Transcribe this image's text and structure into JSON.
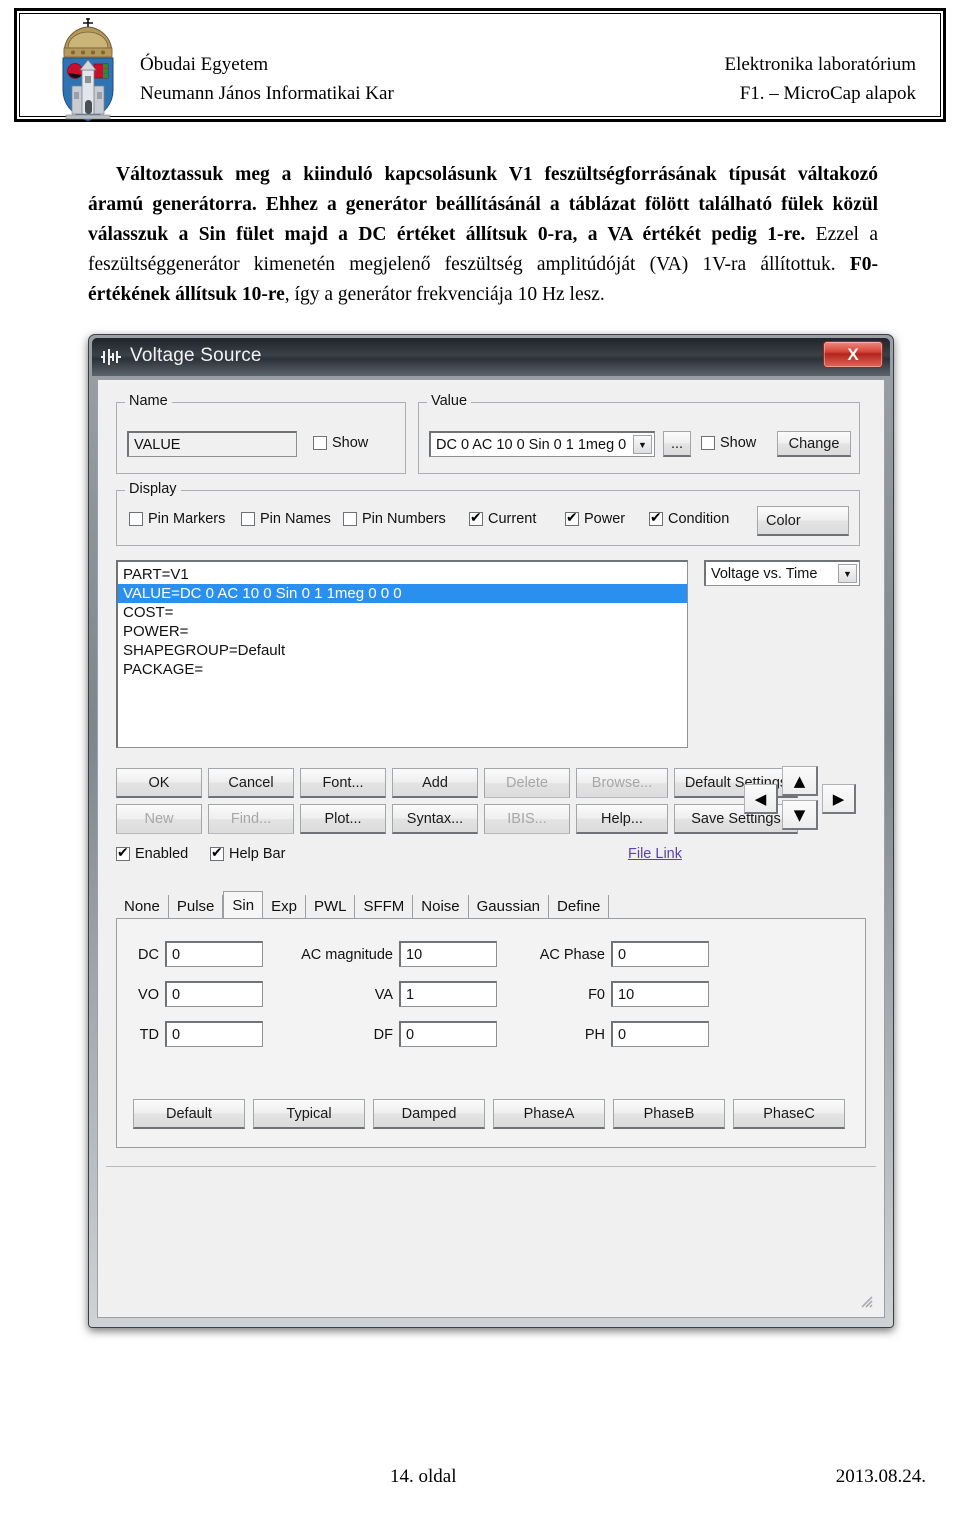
{
  "header": {
    "logo_alt": "obuda-university-crest",
    "left_line1": "Óbudai Egyetem",
    "left_line2": "Neumann János Informatikai Kar",
    "right_line1": "Elektronika laboratórium",
    "right_line2": "F1. – MicroCap alapok"
  },
  "body_text": {
    "p1_bold_a": "Változtassuk meg a kiinduló kapcsolásunk V1 feszültségforrásának típusát váltakozó áramú generátorra. Ehhez a generátor beállításánál a táblázat fölött található fülek közül válasszuk a Sin fület majd a DC értéket állítsuk 0-ra, a VA értékét pedig 1-re.",
    "p1_plain_a": " Ezzel a feszültséggenerátor kimenetén megjelenő feszültség amplitúdóját (VA) 1V-ra állítottuk. ",
    "p1_bold_b": "F0-értékének állítsuk 10-re",
    "p1_plain_b": ", így a generátor frekvenciája 10 Hz lesz."
  },
  "dialog": {
    "title": "Voltage Source",
    "title_icon": "voltage-source-icon",
    "close_label": "X",
    "name_group": {
      "legend": "Name",
      "value": "VALUE",
      "show_label": "Show",
      "show_checked": false
    },
    "value_group": {
      "legend": "Value",
      "value": "DC 0 AC 10 0 Sin 0 1 1meg 0",
      "browse_label": "...",
      "show_label": "Show",
      "show_checked": false,
      "change_label": "Change"
    },
    "display_group": {
      "legend": "Display",
      "checks": [
        {
          "label": "Pin Markers",
          "checked": false
        },
        {
          "label": "Pin Names",
          "checked": false
        },
        {
          "label": "Pin Numbers",
          "checked": false
        },
        {
          "label": "Current",
          "checked": true
        },
        {
          "label": "Power",
          "checked": true
        },
        {
          "label": "Condition",
          "checked": true
        }
      ],
      "color_label": "Color"
    },
    "property_list": [
      {
        "text": "PART=V1",
        "selected": false
      },
      {
        "text": "VALUE=DC 0 AC 10 0 Sin 0 1 1meg 0 0 0",
        "selected": true
      },
      {
        "text": "COST=",
        "selected": false
      },
      {
        "text": "POWER=",
        "selected": false
      },
      {
        "text": "SHAPEGROUP=Default",
        "selected": false
      },
      {
        "text": "PACKAGE=",
        "selected": false
      }
    ],
    "plot_combo": {
      "value": "Voltage vs. Time"
    },
    "buttons_row1": [
      {
        "label": "OK",
        "accel": "O",
        "disabled": false
      },
      {
        "label": "Cancel",
        "accel": "C",
        "disabled": false
      },
      {
        "label": "Font...",
        "accel": "F",
        "disabled": false
      },
      {
        "label": "Add",
        "accel": "A",
        "disabled": false
      },
      {
        "label": "Delete",
        "accel": "D",
        "disabled": true
      },
      {
        "label": "Browse...",
        "accel": "",
        "disabled": true
      },
      {
        "label": "Default Settings",
        "accel": "",
        "disabled": false
      }
    ],
    "buttons_row2": [
      {
        "label": "New",
        "accel": "",
        "disabled": true
      },
      {
        "label": "Find...",
        "accel": "",
        "disabled": true
      },
      {
        "label": "Plot...",
        "accel": "",
        "disabled": false
      },
      {
        "label": "Syntax...",
        "accel": "",
        "disabled": false
      },
      {
        "label": "IBIS...",
        "accel": "",
        "disabled": true
      },
      {
        "label": "Help...",
        "accel": "e",
        "disabled": false
      },
      {
        "label": "Save Settings",
        "accel": "",
        "disabled": false
      }
    ],
    "nav_arrows": {
      "up": "▲",
      "down": "▼",
      "left": "◀",
      "right": "▶"
    },
    "enabled_check": {
      "label": "Enabled",
      "checked": true
    },
    "helpbar_check": {
      "label": "Help Bar",
      "checked": true
    },
    "file_link": "File Link",
    "tabs": [
      {
        "label": "None",
        "active": false
      },
      {
        "label": "Pulse",
        "active": false
      },
      {
        "label": "Sin",
        "active": true
      },
      {
        "label": "Exp",
        "active": false
      },
      {
        "label": "PWL",
        "active": false
      },
      {
        "label": "SFFM",
        "active": false
      },
      {
        "label": "Noise",
        "active": false
      },
      {
        "label": "Gaussian",
        "active": false
      },
      {
        "label": "Define",
        "active": false
      }
    ],
    "params": [
      {
        "label": "DC",
        "value": "0"
      },
      {
        "label": "AC magnitude",
        "value": "10"
      },
      {
        "label": "AC Phase",
        "value": "0"
      },
      {
        "label": "VO",
        "value": "0"
      },
      {
        "label": "VA",
        "value": "1"
      },
      {
        "label": "F0",
        "value": "10"
      },
      {
        "label": "TD",
        "value": "0"
      },
      {
        "label": "DF",
        "value": "0"
      },
      {
        "label": "PH",
        "value": "0"
      }
    ],
    "preset_buttons": [
      {
        "label": "Default"
      },
      {
        "label": "Typical"
      },
      {
        "label": "Damped"
      },
      {
        "label": "PhaseA"
      },
      {
        "label": "PhaseB"
      },
      {
        "label": "PhaseC"
      }
    ]
  },
  "footer": {
    "page": "14. oldal",
    "date": "2013.08.24."
  }
}
